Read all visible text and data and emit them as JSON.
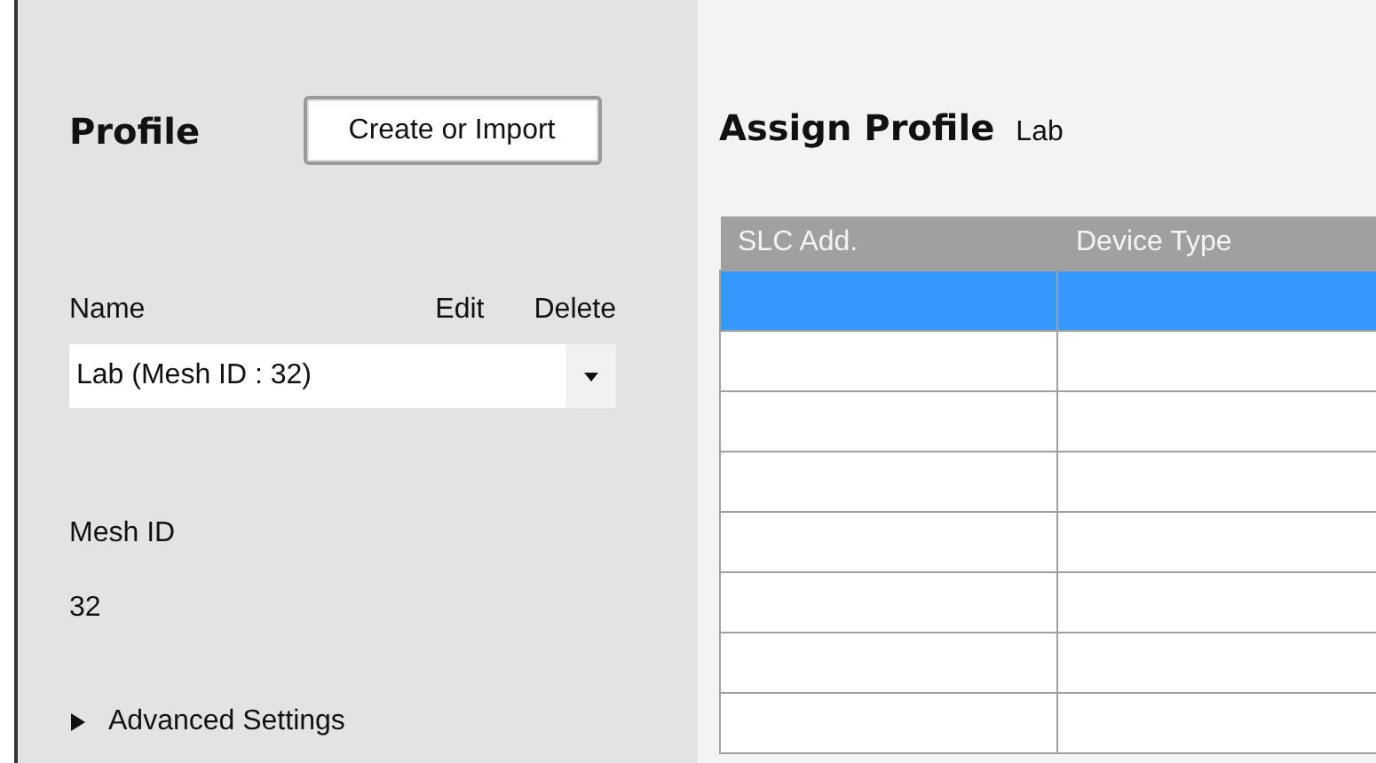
{
  "profile_panel": {
    "title": "Profile",
    "create_button": "Create or Import",
    "columns": [
      "Name",
      "Edit",
      "Delete"
    ],
    "profile_select": {
      "value": "Lab (Mesh ID : 32)"
    },
    "mesh_id_label": "Mesh ID",
    "mesh_id_value": "32",
    "advanced_settings": {
      "label": "Advanced Settings",
      "expanded": false
    }
  },
  "assign_panel": {
    "title": "Assign Profile",
    "profile_name": "Lab",
    "table": {
      "columns": [
        "SLC Add.",
        "Device Type"
      ],
      "rows": [
        {
          "selected": true
        },
        {
          "selected": false
        },
        {
          "selected": false
        },
        {
          "selected": false
        },
        {
          "selected": false
        },
        {
          "selected": false
        },
        {
          "selected": false
        },
        {
          "selected": false
        }
      ]
    }
  }
}
